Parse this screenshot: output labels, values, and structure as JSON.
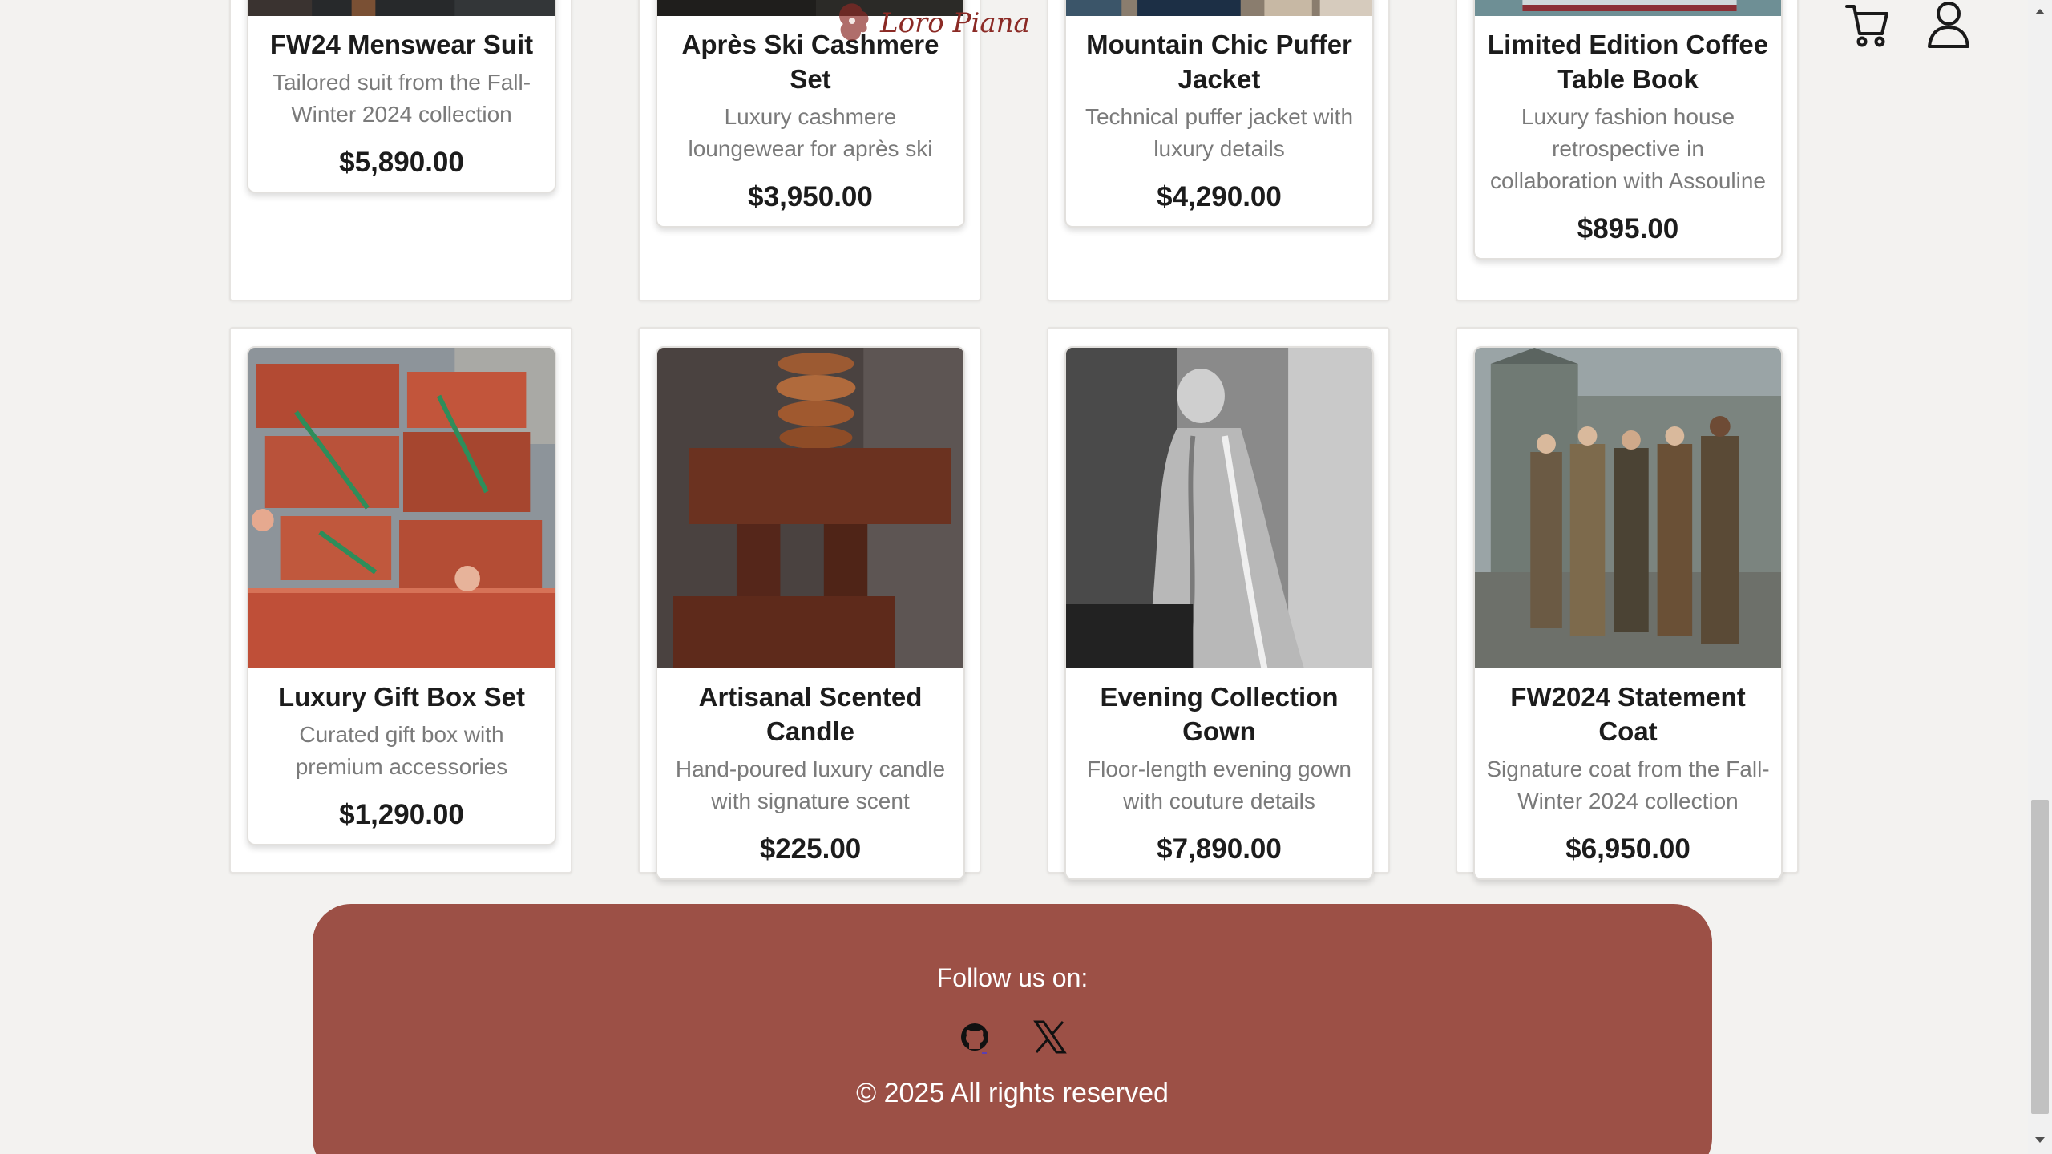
{
  "header": {
    "brand_logo_text": "Loro Piana",
    "cart_icon": "cart-icon",
    "account_icon": "user-icon"
  },
  "products_top": [
    {
      "title": "FW24 Menswear Suit",
      "description": "Tailored suit from the Fall-Winter 2024 collection",
      "price": "$5,890.00"
    },
    {
      "title": "Après Ski Cashmere Set",
      "description": "Luxury cashmere loungewear for après ski",
      "price": "$3,950.00"
    },
    {
      "title": "Mountain Chic Puffer Jacket",
      "description": "Technical puffer jacket with luxury details",
      "price": "$4,290.00"
    },
    {
      "title": "Limited Edition Coffee Table Book",
      "description": "Luxury fashion house retrospective in collaboration with Assouline",
      "price": "$895.00"
    }
  ],
  "products_bottom": [
    {
      "title": "Luxury Gift Box Set",
      "description": "Curated gift box with premium accessories",
      "price": "$1,290.00"
    },
    {
      "title": "Artisanal Scented Candle",
      "description": "Hand-poured luxury candle with signature scent",
      "price": "$225.00"
    },
    {
      "title": "Evening Collection Gown",
      "description": "Floor-length evening gown with couture details",
      "price": "$7,890.00"
    },
    {
      "title": "FW2024 Statement Coat",
      "description": "Signature coat from the Fall-Winter 2024 collection",
      "price": "$6,950.00"
    }
  ],
  "footer": {
    "follow_label": "Follow us on:",
    "social_icons": [
      "github-icon",
      "x-icon"
    ],
    "copyright": "© 2025 All rights reserved"
  },
  "colors": {
    "footer_bg": "#9c5046",
    "page_bg": "#f3f2f0",
    "brand_logo": "#8b2a25"
  }
}
